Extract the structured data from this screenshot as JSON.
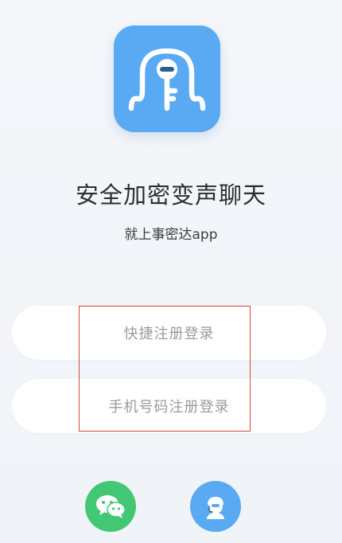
{
  "hero": {
    "title": "安全加密变声聊天",
    "subtitle": "就上事密达app"
  },
  "auth": {
    "quick_register_label": "快捷注册登录",
    "phone_register_label": "手机号码注册登录"
  },
  "social": {
    "wechat_icon": "wechat-icon",
    "support_icon": "support-agent-icon"
  },
  "colors": {
    "brand_blue": "#5aa9f3",
    "wechat_green": "#42c874",
    "highlight_red": "#d9483b"
  }
}
